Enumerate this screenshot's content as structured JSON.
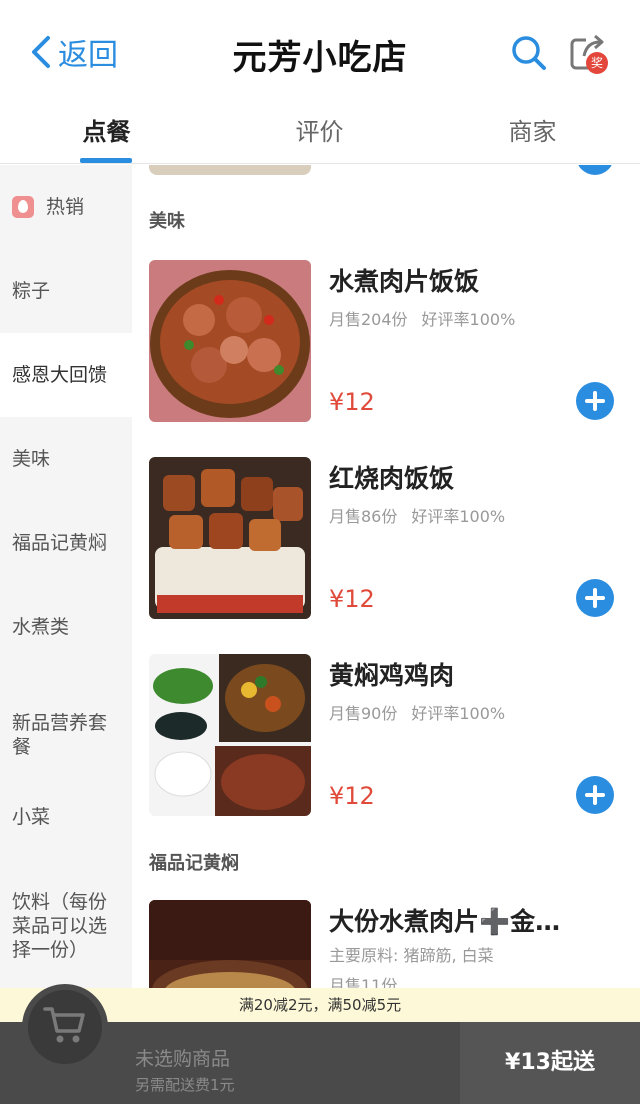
{
  "header": {
    "back_label": "返回",
    "title": "元芳小吃店",
    "share_badge": "奖"
  },
  "tabs": [
    {
      "label": "点餐",
      "active": true
    },
    {
      "label": "评价",
      "active": false
    },
    {
      "label": "商家",
      "active": false
    }
  ],
  "sidebar": {
    "items": [
      {
        "label": "热销",
        "icon": "fire-icon"
      },
      {
        "label": "粽子"
      },
      {
        "label": "感恩大回馈",
        "active": true
      },
      {
        "label": "美味"
      },
      {
        "label": "福品记黄焖"
      },
      {
        "label": "水煮类"
      },
      {
        "label": "新品营养套餐"
      },
      {
        "label": "小菜"
      },
      {
        "label": "饮料（每份菜品可以选择一份）"
      }
    ]
  },
  "content": {
    "sections": [
      {
        "title": "美味",
        "items": [
          {
            "name": "水煮肉片饭饭",
            "sales": "月售204份",
            "rating": "好评率100%",
            "price": "¥12"
          },
          {
            "name": "红烧肉饭饭",
            "sales": "月售86份",
            "rating": "好评率100%",
            "price": "¥12"
          },
          {
            "name": "黄焖鸡鸡肉",
            "sales": "月售90份",
            "rating": "好评率100%",
            "price": "¥12"
          }
        ]
      },
      {
        "title": "福品记黄焖",
        "items": [
          {
            "name": "大份水煮肉片➕金…",
            "ingredients": "主要原料: 猪蹄筋, 白菜",
            "sales": "月售11份"
          }
        ]
      }
    ]
  },
  "promo": "满20减2元，满50减5元",
  "cart": {
    "status": "未选购商品",
    "delivery_fee": "另需配送费1元",
    "min_order": "¥13起送"
  },
  "colors": {
    "accent": "#2a8de0",
    "price": "#e04a3a",
    "cartbar": "#4a4a4a",
    "promo_bg": "#fdf8d8"
  }
}
